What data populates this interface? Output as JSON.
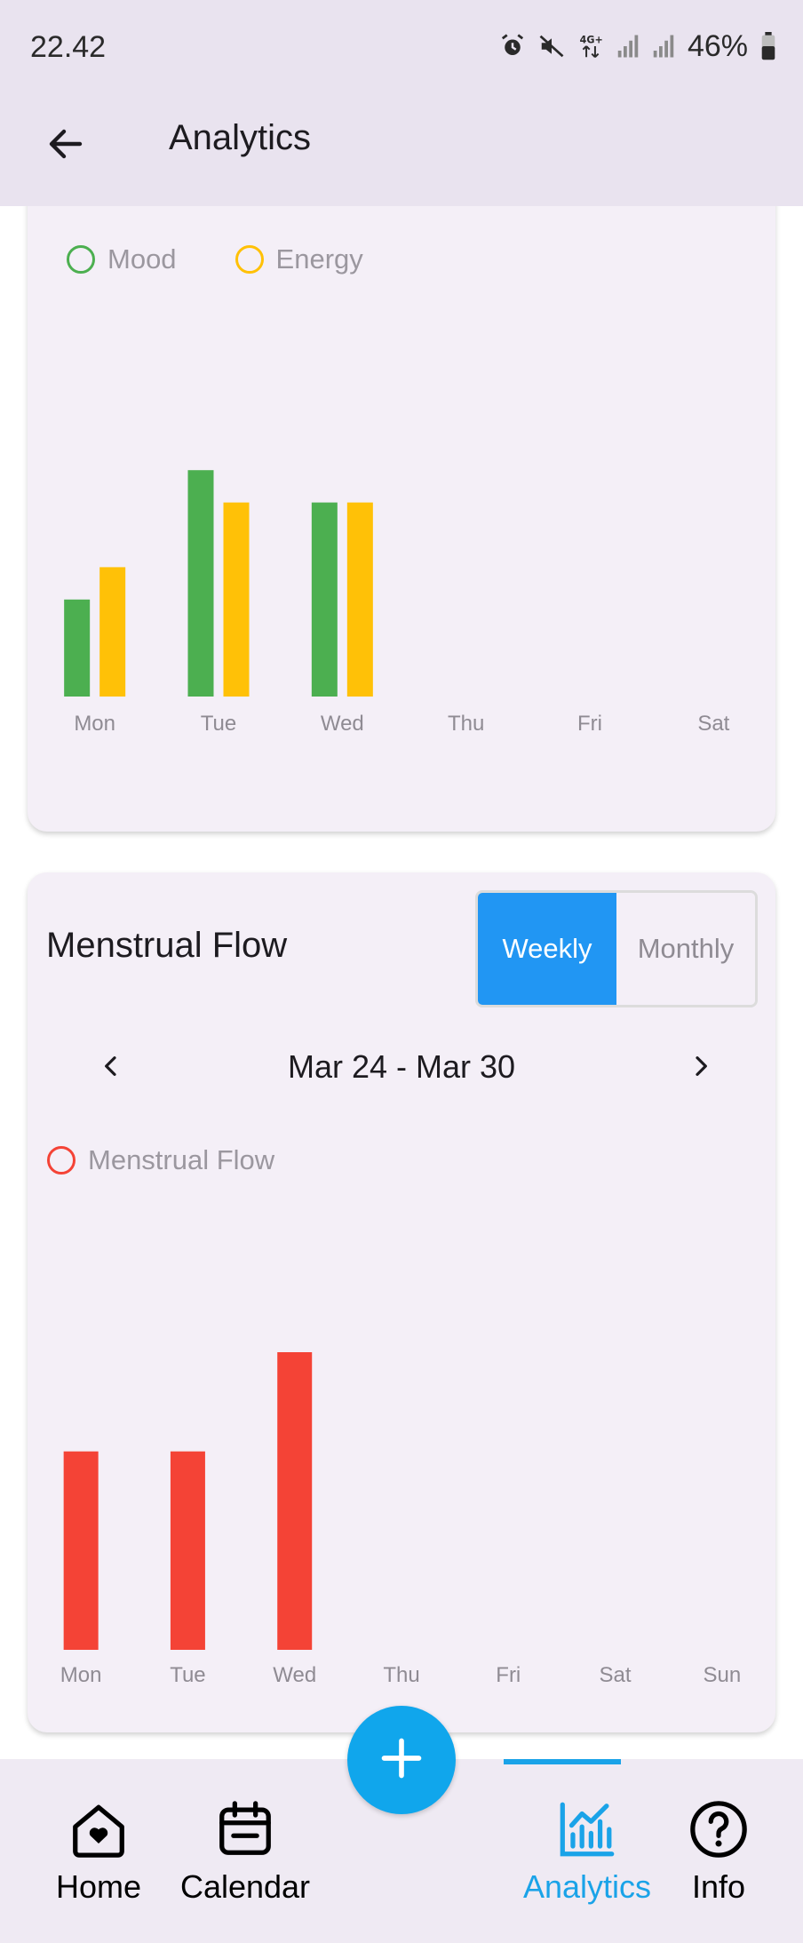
{
  "status_bar": {
    "time": "22.42",
    "battery": "46%"
  },
  "app_bar": {
    "title": "Analytics"
  },
  "mood_energy_chart": {
    "legend": [
      {
        "label": "Mood",
        "color": "#4caf50"
      },
      {
        "label": "Energy",
        "color": "#ffc107"
      }
    ]
  },
  "flow_card": {
    "title": "Menstrual Flow",
    "toggle": {
      "weekly": "Weekly",
      "monthly": "Monthly",
      "selected": "Weekly"
    },
    "date_range": "Mar 24 - Mar 30",
    "legend": [
      {
        "label": "Menstrual Flow",
        "color": "#f44336"
      }
    ]
  },
  "chart_data": [
    {
      "type": "bar",
      "categories": [
        "Mon",
        "Tue",
        "Wed",
        "Thu",
        "Fri",
        "Sat"
      ],
      "series": [
        {
          "name": "Mood",
          "color": "#4caf50",
          "values": [
            3,
            7,
            6,
            null,
            null,
            null
          ]
        },
        {
          "name": "Energy",
          "color": "#ffc107",
          "values": [
            4,
            6,
            6,
            null,
            null,
            null
          ]
        }
      ],
      "ylim": [
        0,
        10
      ],
      "grid": false,
      "legend_position": "top-left"
    },
    {
      "type": "bar",
      "categories": [
        "Mon",
        "Tue",
        "Wed",
        "Thu",
        "Fri",
        "Sat",
        "Sun"
      ],
      "series": [
        {
          "name": "Menstrual Flow",
          "color": "#f44336",
          "values": [
            2,
            2,
            3,
            null,
            null,
            null,
            null
          ]
        }
      ],
      "ylim": [
        0,
        3
      ],
      "grid": false,
      "legend_position": "top-left"
    }
  ],
  "bottom_nav": {
    "items": [
      {
        "label": "Home",
        "icon": "home-heart-icon"
      },
      {
        "label": "Calendar",
        "icon": "calendar-icon"
      },
      {
        "label": "Analytics",
        "icon": "analytics-chart-icon",
        "active": true
      },
      {
        "label": "Info",
        "icon": "help-circle-icon"
      }
    ],
    "fab_icon": "plus-icon",
    "active_color": "#1aa3e8"
  }
}
